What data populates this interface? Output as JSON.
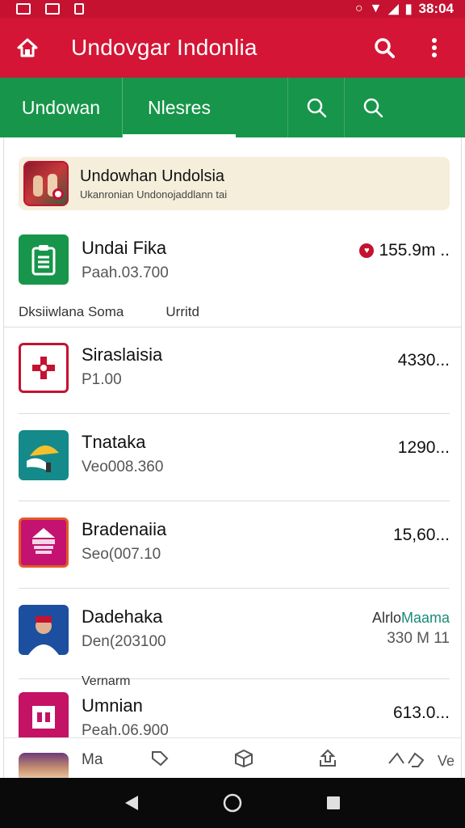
{
  "status_bar": {
    "time": "38:04"
  },
  "app_bar": {
    "title": "Undovgar Indonlia"
  },
  "tabs": [
    {
      "label": "Undowan"
    },
    {
      "label": "Nlesres"
    }
  ],
  "banner": {
    "title": "Undowhan Undolsia",
    "subtitle": "Ukanronian Undonojaddlann tai"
  },
  "featured": {
    "name": "Undai Fika",
    "sub": "Paah.03.700",
    "value": "155.9m .."
  },
  "section_labels": [
    "Dksiiwlana Soma",
    "Urritd"
  ],
  "list": [
    {
      "name": "Siraslaisia",
      "sub": "P1.00",
      "value": "4330..."
    },
    {
      "name": "Tnataka",
      "sub": "Veo008.360",
      "value": "1290..."
    },
    {
      "name": "Bradenaiia",
      "sub": "Seo(007.10",
      "value": "15,60..."
    },
    {
      "name": "Dadehaka",
      "sub": "Den(203100",
      "value_top_dark": "Alrlo",
      "value_top_teal": "Maama",
      "value_bottom": "330 M 11"
    },
    {
      "pre_label": "Vernarm",
      "name": "Umnian",
      "sub": "Peah.06.900",
      "value": "613.0..."
    }
  ],
  "bottom_tools": {
    "label": "Ma",
    "end_label": "Ve"
  },
  "colors": {
    "red": "#d41535",
    "green": "#17954a",
    "accent": "#c41230"
  }
}
